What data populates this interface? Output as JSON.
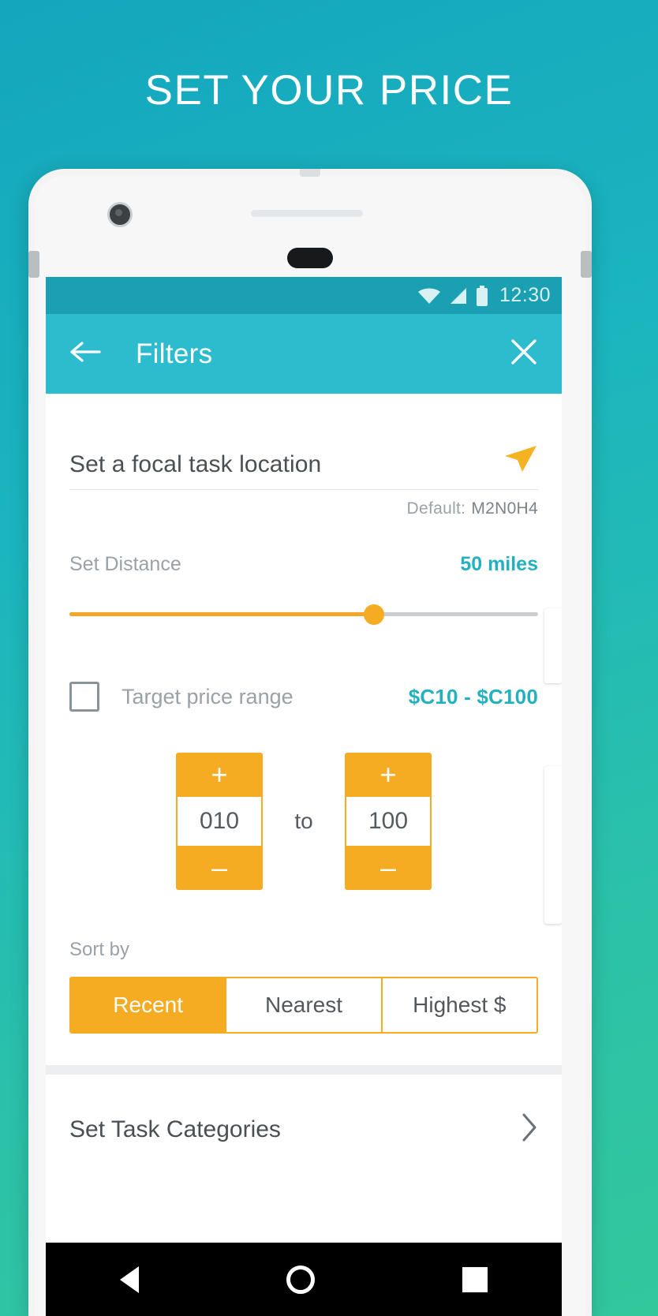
{
  "headline": "SET YOUR PRICE",
  "theme": {
    "background_gradient_from": "#14a6bd",
    "background_gradient_to": "#33c79c",
    "statusbar_color": "#1b9fb2",
    "appbar_color": "#2cbcce",
    "accent_orange": "#f5ab22",
    "accent_teal": "#23b0bf"
  },
  "statusbar": {
    "time": "12:30",
    "icons": [
      "wifi-icon",
      "cell-signal-icon",
      "battery-icon"
    ]
  },
  "appbar": {
    "back_icon": "arrow-left-icon",
    "title": "Filters",
    "close_icon": "close-icon"
  },
  "filters": {
    "location": {
      "label": "Set a focal task location",
      "action_icon": "send-location-icon",
      "default_prefix": "Default:",
      "default_value": "M2N0H4"
    },
    "distance": {
      "label": "Set Distance",
      "value": "50 miles",
      "percent": 65
    },
    "price_range": {
      "checkbox_checked": false,
      "label": "Target price range",
      "value": "$C10 - $C100",
      "min": {
        "plus": "+",
        "value": "010",
        "minus": "–"
      },
      "separator": "to",
      "max": {
        "plus": "+",
        "value": "100",
        "minus": "–"
      }
    },
    "sort": {
      "label": "Sort by",
      "options": [
        {
          "label": "Recent",
          "active": true
        },
        {
          "label": "Nearest",
          "active": false
        },
        {
          "label": "Highest $",
          "active": false
        }
      ]
    },
    "categories": {
      "label": "Set Task Categories",
      "chevron_icon": "chevron-right-icon"
    }
  },
  "navbar": {
    "back": "nav-back-triangle-icon",
    "home": "nav-home-circle-icon",
    "recents": "nav-recents-square-icon"
  }
}
